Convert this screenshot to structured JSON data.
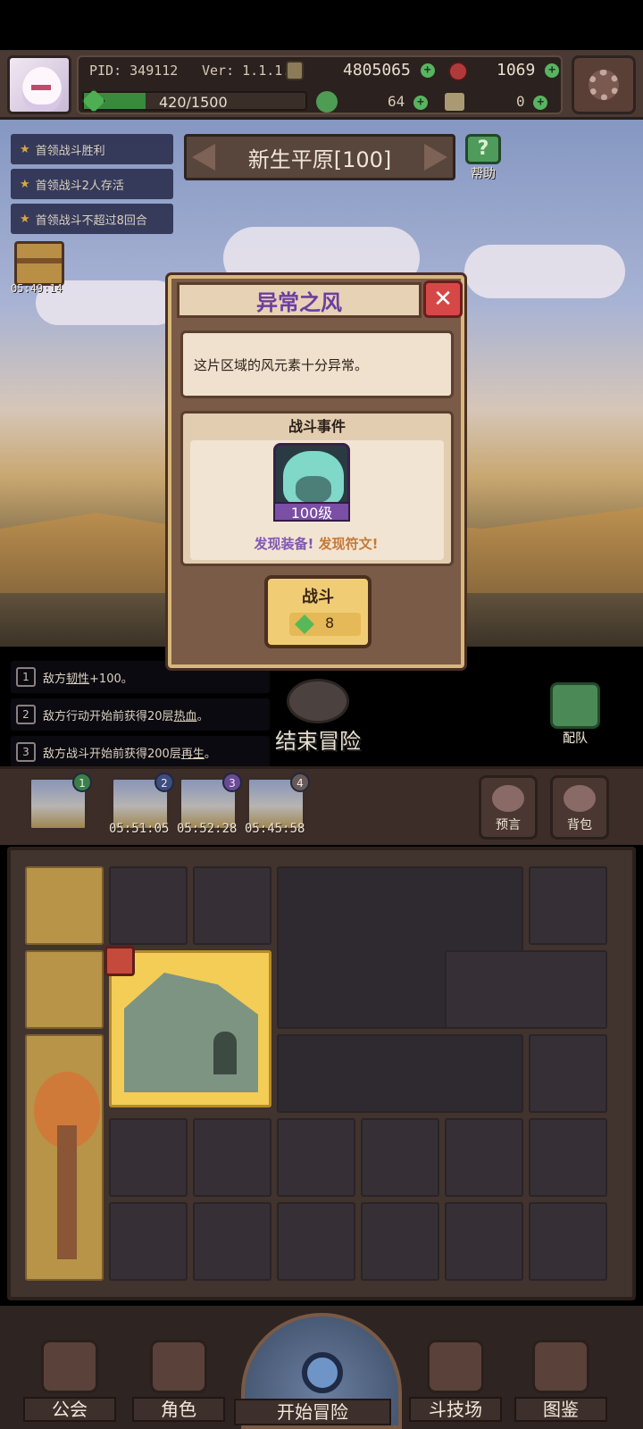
{
  "header": {
    "pid": "PID: 349112",
    "version": "Ver: 1.1.1.2",
    "gold": "4805065",
    "gems": "1069",
    "energy": "420/1500",
    "energy_fraction": 0.28,
    "clover": "64",
    "hammer": "0",
    "settings_icon": "gear-icon"
  },
  "quests": [
    {
      "label": "首领战斗胜利"
    },
    {
      "label": "首领战斗2人存活"
    },
    {
      "label": "首领战斗不超过8回合"
    }
  ],
  "area": {
    "title": "新生平原[100]",
    "help_label": "帮助"
  },
  "chest_timer": "05:49:14",
  "modal": {
    "title": "异常之风",
    "description": "这片区域的风元素十分异常。",
    "section_title": "战斗事件",
    "monster_level": "100级",
    "loot_equip": "发现装备!",
    "loot_rune": "发现符文!",
    "fight_label": "战斗",
    "fight_cost": "8"
  },
  "effects": [
    {
      "num": "1",
      "pre": "敌方",
      "key": "韧性",
      "post": "+100。"
    },
    {
      "num": "2",
      "pre": "敌方行动开始前获得20层",
      "key": "热血",
      "post": "。"
    },
    {
      "num": "3",
      "pre": "敌方战斗开始前获得200层",
      "key": "再生",
      "post": "。"
    }
  ],
  "end_adventure": "结束冒险",
  "team_label": "配队",
  "queue": [
    {
      "num": "1",
      "time": ""
    },
    {
      "num": "2",
      "time": "05:51:05"
    },
    {
      "num": "3",
      "time": "05:52:28"
    },
    {
      "num": "4",
      "time": "05:45:58"
    }
  ],
  "side_buttons": {
    "prophecy": "预言",
    "bag": "背包"
  },
  "nav": {
    "guild": "公会",
    "character": "角色",
    "start": "开始冒险",
    "arena": "斗技场",
    "codex": "图鉴"
  }
}
